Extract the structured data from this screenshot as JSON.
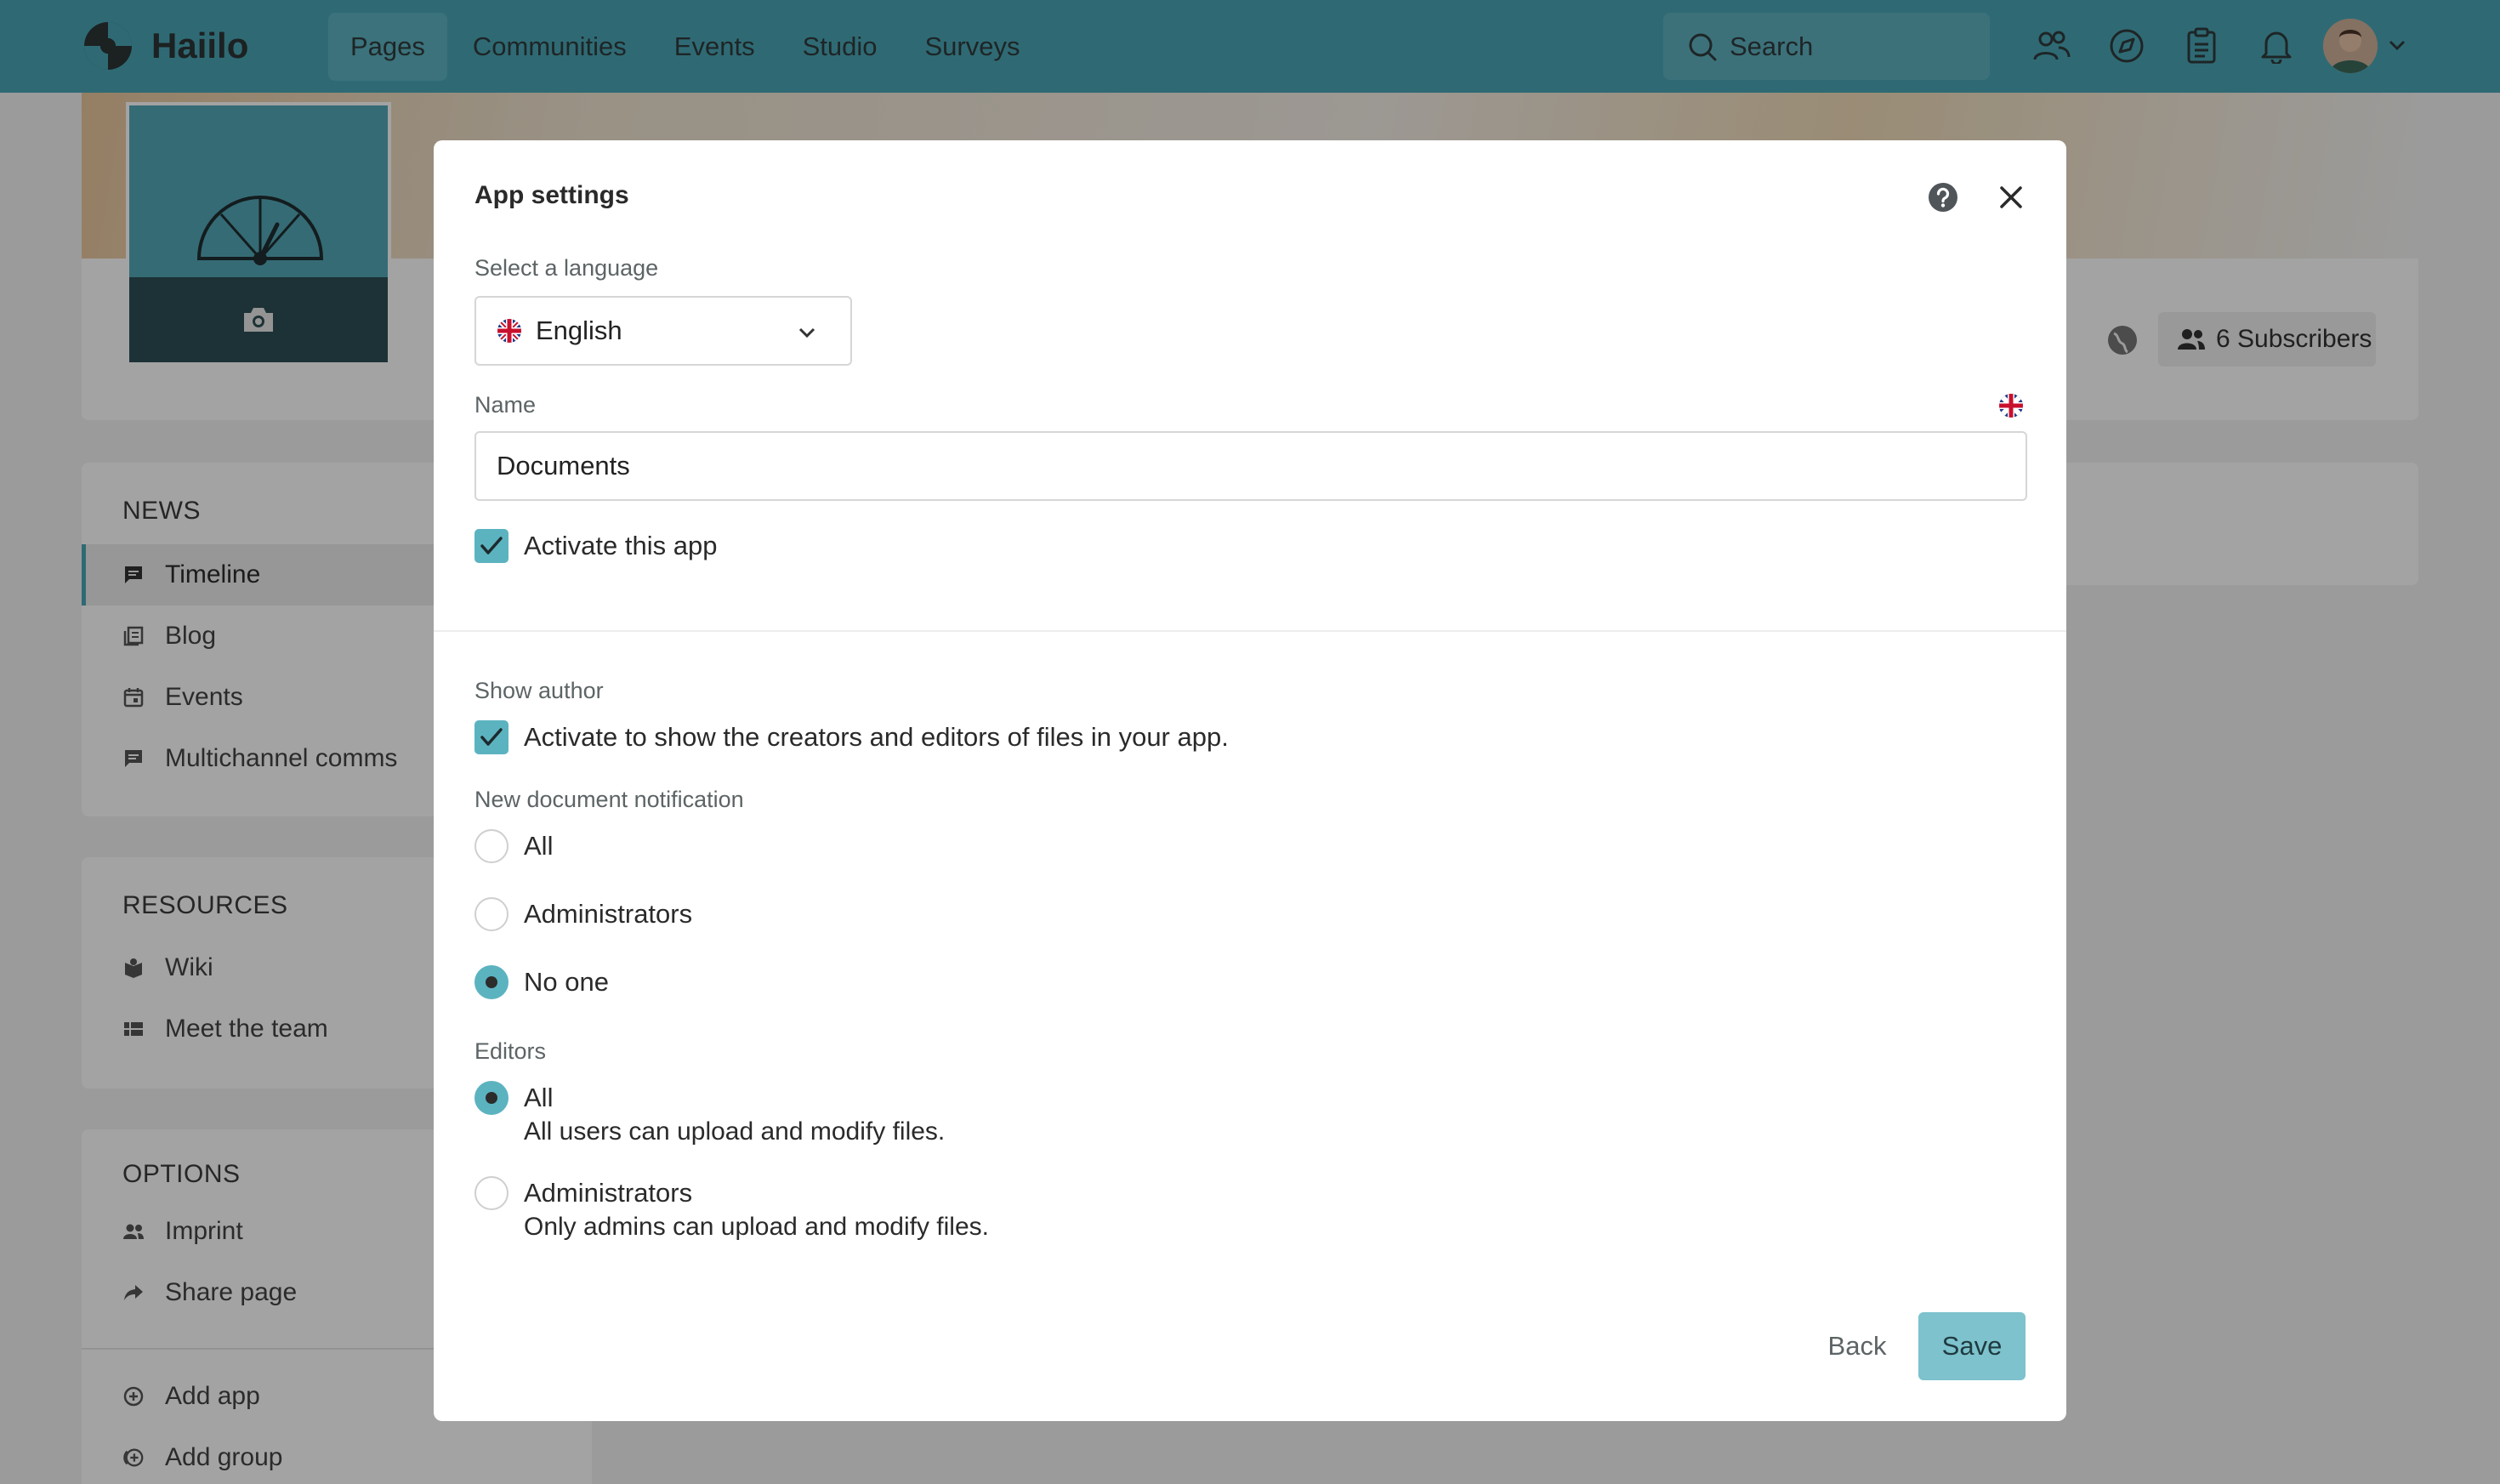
{
  "app": {
    "name": "Haiilo"
  },
  "nav": {
    "items": [
      {
        "label": "Pages",
        "active": true
      },
      {
        "label": "Communities",
        "active": false
      },
      {
        "label": "Events",
        "active": false
      },
      {
        "label": "Studio",
        "active": false
      },
      {
        "label": "Surveys",
        "active": false
      }
    ],
    "search_placeholder": "Search",
    "icons": [
      "people-icon",
      "compass-icon",
      "clipboard-icon",
      "bell-icon"
    ]
  },
  "page": {
    "subscribers_label": "6 Subscribers",
    "sidebar": {
      "news": {
        "title": "NEWS",
        "items": [
          {
            "label": "Timeline",
            "icon": "chat-icon",
            "active": true
          },
          {
            "label": "Blog",
            "icon": "blog-icon",
            "active": false
          },
          {
            "label": "Events",
            "icon": "calendar-icon",
            "active": false
          },
          {
            "label": "Multichannel comms",
            "icon": "chat-icon",
            "active": false
          }
        ]
      },
      "resources": {
        "title": "RESOURCES",
        "items": [
          {
            "label": "Wiki",
            "icon": "book-icon"
          },
          {
            "label": "Meet the team",
            "icon": "team-icon"
          }
        ]
      },
      "options": {
        "title": "OPTIONS",
        "items": [
          {
            "label": "Imprint",
            "icon": "users-icon"
          },
          {
            "label": "Share page",
            "icon": "share-icon"
          },
          {
            "label": "Add app",
            "icon": "add-circle-icon"
          },
          {
            "label": "Add group",
            "icon": "add-group-icon"
          }
        ]
      }
    }
  },
  "modal": {
    "title": "App settings",
    "language_label": "Select a language",
    "language_value": "English",
    "name_label": "Name",
    "name_value": "Documents",
    "activate_label": "Activate this app",
    "activate_checked": true,
    "show_author_label": "Show author",
    "show_author_checkbox_label": "Activate to show the creators and editors of files in your app.",
    "show_author_checked": true,
    "notification_label": "New document notification",
    "notification_options": [
      {
        "label": "All",
        "selected": false
      },
      {
        "label": "Administrators",
        "selected": false
      },
      {
        "label": "No one",
        "selected": true
      }
    ],
    "editors_label": "Editors",
    "editors_options": [
      {
        "label": "All",
        "description": "All users can upload and modify files.",
        "selected": true
      },
      {
        "label": "Administrators",
        "description": "Only admins can upload and modify files.",
        "selected": false
      }
    ],
    "back_label": "Back",
    "save_label": "Save"
  },
  "colors": {
    "brand": "#4aa6b6",
    "accent": "#5cb3c0",
    "save_button": "#7dc2cd"
  }
}
